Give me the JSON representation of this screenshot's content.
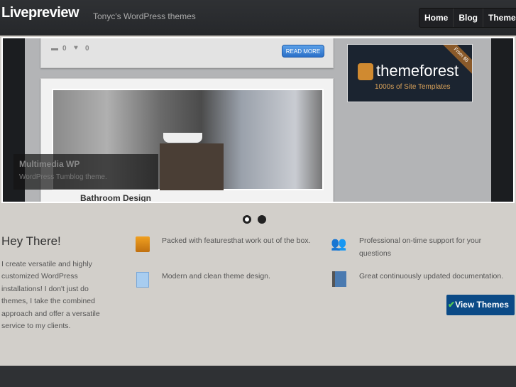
{
  "header": {
    "logo": "Livepreview",
    "tagline": "Tonyc's WordPress themes",
    "nav": [
      "Home",
      "Blog",
      "Themes"
    ]
  },
  "slider": {
    "comments": "0",
    "likes": "0",
    "read_more": "READ MORE",
    "post_title": "Bathroom Design",
    "caption_title": "Multimedia WP",
    "caption_sub": "WordPress Tumblog theme.",
    "ad": {
      "logo": "themeforest",
      "sub": "1000s of Site Templates",
      "ribbon": "From $5"
    }
  },
  "intro": {
    "title": "Hey There!",
    "text": "I create versatile and highly customized WordPress installations! I don't just do themes, I take the combined approach and offer a versatile service to my clients."
  },
  "features": [
    {
      "icon": "box-icon",
      "text": "Packed with featuresthat work out of the box."
    },
    {
      "icon": "users-icon",
      "text": "Professional on-time support for your questions"
    },
    {
      "icon": "document-icon",
      "text": "Modern and clean theme design."
    },
    {
      "icon": "book-icon",
      "text": "Great continuously updated  documentation."
    }
  ],
  "cta": {
    "check": "✔",
    "label": "View Themes"
  },
  "colors": {
    "header": "#2b2d30",
    "cta": "#0b4a86",
    "body": "#d2cfca"
  }
}
